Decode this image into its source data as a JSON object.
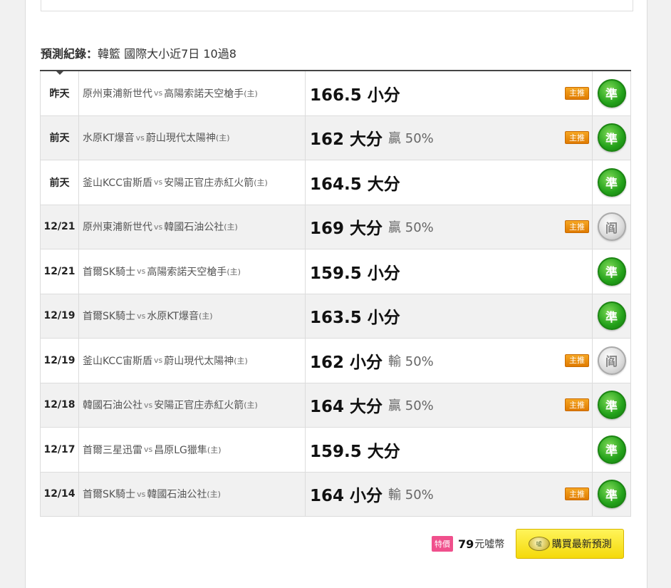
{
  "heading": {
    "label": "預測紀錄：",
    "value": "韓籃 國際大小近7日 10過8"
  },
  "rows": [
    {
      "date": "昨天",
      "team_a": "原州東浦新世代",
      "vs": "vs",
      "team_b": "高陽索諾天空槍手",
      "home": "(主)",
      "pick": "166.5 小分",
      "extra": "",
      "badge": "主推",
      "result": "準",
      "result_type": "win"
    },
    {
      "date": "前天",
      "team_a": "水原KT爆音",
      "vs": "vs",
      "team_b": "蔚山現代太陽神",
      "home": "(主)",
      "pick": "162 大分",
      "extra": "贏 50%",
      "badge": "主推",
      "result": "準",
      "result_type": "win"
    },
    {
      "date": "前天",
      "team_a": "釜山KCC宙斯盾",
      "vs": "vs",
      "team_b": "安陽正官庄赤紅火箭",
      "home": "(主)",
      "pick": "164.5 大分",
      "extra": "",
      "badge": "",
      "result": "準",
      "result_type": "win"
    },
    {
      "date": "12/21",
      "team_a": "原州東浦新世代",
      "vs": "vs",
      "team_b": "韓國石油公社",
      "home": "(主)",
      "pick": "169 大分",
      "extra": "贏 50%",
      "badge": "主推",
      "result": "阎",
      "result_type": "push"
    },
    {
      "date": "12/21",
      "team_a": "首爾SK騎士",
      "vs": "vs",
      "team_b": "高陽索諾天空槍手",
      "home": "(主)",
      "pick": "159.5 小分",
      "extra": "",
      "badge": "",
      "result": "準",
      "result_type": "win"
    },
    {
      "date": "12/19",
      "team_a": "首爾SK騎士",
      "vs": "vs",
      "team_b": "水原KT爆音",
      "home": "(主)",
      "pick": "163.5 小分",
      "extra": "",
      "badge": "",
      "result": "準",
      "result_type": "win"
    },
    {
      "date": "12/19",
      "team_a": "釜山KCC宙斯盾",
      "vs": "vs",
      "team_b": "蔚山現代太陽神",
      "home": "(主)",
      "pick": "162 小分",
      "extra": "輸 50%",
      "badge": "主推",
      "result": "阎",
      "result_type": "push"
    },
    {
      "date": "12/18",
      "team_a": "韓國石油公社",
      "vs": "vs",
      "team_b": "安陽正官庄赤紅火箭",
      "home": "(主)",
      "pick": "164 大分",
      "extra": "贏 50%",
      "badge": "主推",
      "result": "準",
      "result_type": "win"
    },
    {
      "date": "12/17",
      "team_a": "首爾三星迅雷",
      "vs": "vs",
      "team_b": "昌原LG獵隼",
      "home": "(主)",
      "pick": "159.5 大分",
      "extra": "",
      "badge": "",
      "result": "準",
      "result_type": "win"
    },
    {
      "date": "12/14",
      "team_a": "首爾SK騎士",
      "vs": "vs",
      "team_b": "韓國石油公社",
      "home": "(主)",
      "pick": "164 小分",
      "extra": "輸 50%",
      "badge": "主推",
      "result": "準",
      "result_type": "win"
    }
  ],
  "footer": {
    "promo_tag": "特價",
    "price": "79",
    "unit": "元噓幣",
    "coin_icon_text": "噓",
    "buy_label": "購買最新預測"
  },
  "colors": {
    "win": "#23a11a",
    "push": "#b5b5b5",
    "badge": "#e07b00",
    "buy_button": "#f4d90a",
    "promo": "#f0508c"
  }
}
